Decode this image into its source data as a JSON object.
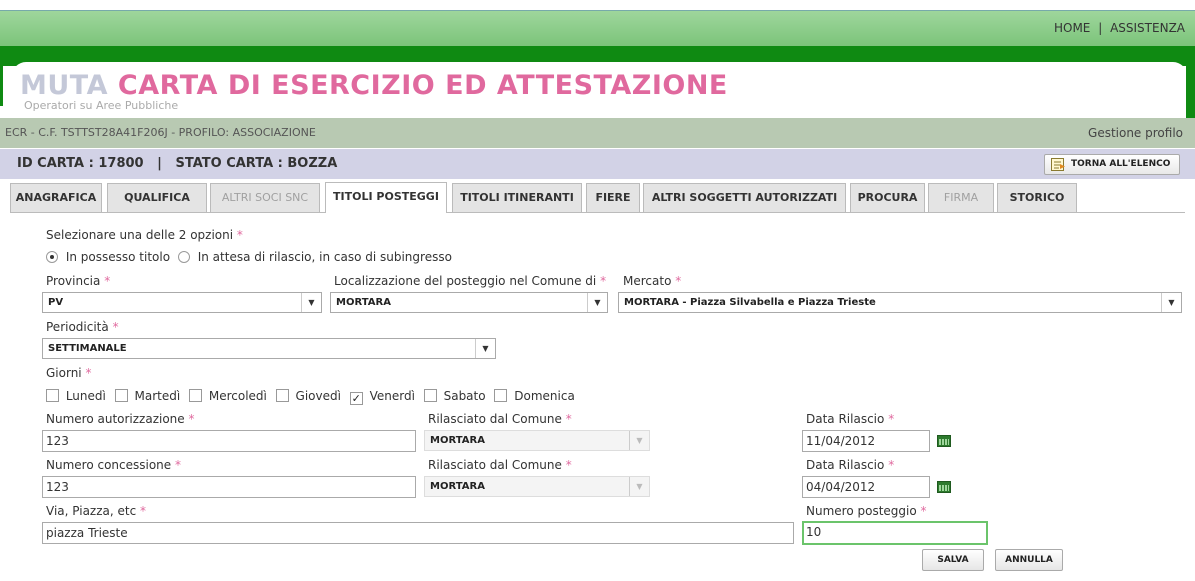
{
  "header": {
    "links": [
      "HOME",
      "ASSISTENZA"
    ],
    "separator": "|"
  },
  "app": {
    "title_part1": "MUTA",
    "title_part2": "CARTA DI ESERCIZIO ED ATTESTAZIONE",
    "subtitle": "Operatori su Aree Pubbliche"
  },
  "user": {
    "info": "ECR - C.F. TSTTST28A41F206J - PROFILO: ASSOCIAZIONE",
    "profile_link": "Gestione profilo"
  },
  "card": {
    "info": "ID CARTA : 17800   |   STATO CARTA : BOZZA",
    "back_button": "TORNA ALL'ELENCO"
  },
  "tabs": [
    "ANAGRAFICA",
    "QUALIFICA",
    "ALTRI SOCI SNC",
    "TITOLI POSTEGGI",
    "TITOLI ITINERANTI",
    "FIERE",
    "ALTRI SOGGETTI AUTORIZZATI",
    "PROCURA",
    "FIRMA",
    "STORICO"
  ],
  "active_tab": "TITOLI POSTEGGI",
  "disabled_tabs": [
    "ALTRI SOCI SNC",
    "FIRMA"
  ],
  "form": {
    "required_mark": "*",
    "select_option_label": "Selezionare una delle 2 opzioni",
    "options": [
      {
        "label": "In possesso titolo",
        "selected": true
      },
      {
        "label": "In attesa di rilascio, in caso di subingresso",
        "selected": false
      }
    ],
    "provincia": {
      "label": "Provincia",
      "value": "PV"
    },
    "localizzazione": {
      "label": "Localizzazione del posteggio nel Comune di",
      "value": "MORTARA"
    },
    "mercato": {
      "label": "Mercato",
      "value": "MORTARA - Piazza Silvabella e Piazza Trieste"
    },
    "periodicita": {
      "label": "Periodicità",
      "value": "SETTIMANALE"
    },
    "giorni": {
      "label": "Giorni",
      "days": [
        {
          "label": "Lunedì",
          "checked": false
        },
        {
          "label": "Martedì",
          "checked": false
        },
        {
          "label": "Mercoledì",
          "checked": false
        },
        {
          "label": "Giovedì",
          "checked": false
        },
        {
          "label": "Venerdì",
          "checked": true
        },
        {
          "label": "Sabato",
          "checked": false
        },
        {
          "label": "Domenica",
          "checked": false
        }
      ]
    },
    "num_autorizzazione": {
      "label": "Numero autorizzazione",
      "value": "123"
    },
    "rilasciato_aut": {
      "label": "Rilasciato dal Comune",
      "value": "MORTARA"
    },
    "data_rilascio_aut": {
      "label": "Data Rilascio",
      "value": "11/04/2012"
    },
    "num_concessione": {
      "label": "Numero concessione",
      "value": "123"
    },
    "rilasciato_conc": {
      "label": "Rilasciato dal Comune",
      "value": "MORTARA"
    },
    "data_rilascio_conc": {
      "label": "Data Rilascio",
      "value": "04/04/2012"
    },
    "via": {
      "label": "Via, Piazza, etc",
      "value": "piazza Trieste"
    },
    "num_posteggio": {
      "label": "Numero posteggio",
      "value": "10"
    },
    "save_button": "SALVA",
    "cancel_button": "ANNULLA"
  },
  "colors": {
    "green": "#0f8a12",
    "pink": "#e0699e",
    "lavender": "#d2d2e6",
    "sage": "#b8c9b2"
  }
}
